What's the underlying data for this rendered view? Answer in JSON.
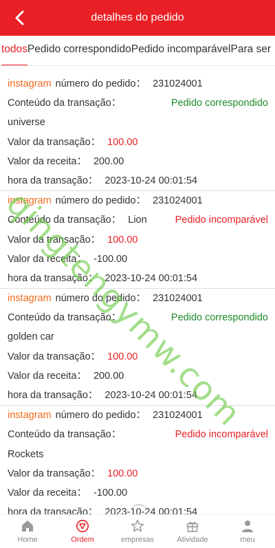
{
  "header": {
    "title": "detalhes do pedido",
    "back_icon": "chevron-left-icon"
  },
  "tabs": [
    {
      "label": "todos"
    },
    {
      "label": "Pedido correspondido"
    },
    {
      "label": "Pedido incomparável"
    },
    {
      "label": "Para ser"
    }
  ],
  "field_labels": {
    "order_number": "número do pedido",
    "content": "Conteúdo da transação",
    "amount": "Valor da transação",
    "receipt": "Valor da receita",
    "time": "hora da transação",
    "colon": "："
  },
  "orders": [
    {
      "platform": "instagram",
      "order_number": "231024001",
      "status": "Pedido correspondido",
      "item": "universe",
      "amount": "100.00",
      "receipt": "200.00",
      "time": "2023-10-24 00:01:54"
    },
    {
      "platform": "instagram",
      "order_number": "231024001",
      "status": "Pedido incomparável",
      "item": "Lion",
      "amount": "100.00",
      "receipt": "-100.00",
      "time": "2023-10-24 00:01:54"
    },
    {
      "platform": "instagram",
      "order_number": "231024001",
      "status": "Pedido correspondido",
      "item": "golden car",
      "amount": "100.00",
      "receipt": "200.00",
      "time": "2023-10-24 00:01:54"
    },
    {
      "platform": "instagram",
      "order_number": "231024001",
      "status": "Pedido incomparável",
      "item": "Rockets",
      "amount": "100.00",
      "receipt": "-100.00",
      "time": "2023-10-24 00:01:54"
    }
  ],
  "watermark": "qingtengymw.com",
  "nav": [
    {
      "label": "Home",
      "icon": "home-icon"
    },
    {
      "label": "Ordem",
      "icon": "order-icon"
    },
    {
      "label": "empresas",
      "icon": "star-icon"
    },
    {
      "label": "Atividade",
      "icon": "gift-icon"
    },
    {
      "label": "meu",
      "icon": "user-icon"
    }
  ],
  "colors": {
    "brand_red": "#e81f25",
    "platform_orange": "#f26b1d",
    "status_green": "#1d8b2a"
  }
}
